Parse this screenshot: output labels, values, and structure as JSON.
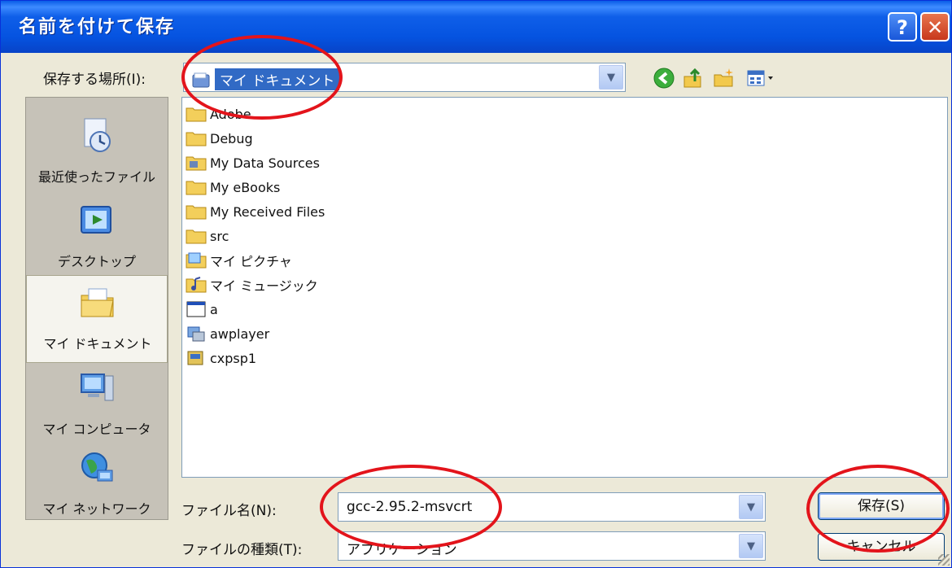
{
  "window": {
    "title": "名前を付けて保存",
    "help_glyph": "?",
    "close_glyph": "✕"
  },
  "location": {
    "label": "保存する場所(I):",
    "value": "マイ ドキュメント"
  },
  "toolbar": {
    "back_icon": "back-icon",
    "up_icon": "up-folder-icon",
    "new_folder_icon": "new-folder-icon",
    "views_icon": "views-menu-icon"
  },
  "places": [
    {
      "label": "最近使ったファイル",
      "icon": "recent-documents-icon"
    },
    {
      "label": "デスクトップ",
      "icon": "desktop-icon"
    },
    {
      "label": "マイ ドキュメント",
      "icon": "my-documents-icon",
      "active": true
    },
    {
      "label": "マイ コンピュータ",
      "icon": "my-computer-icon"
    },
    {
      "label": "マイ ネットワーク",
      "icon": "my-network-icon"
    }
  ],
  "files": [
    {
      "name": "Adobe",
      "icon": "folder-icon"
    },
    {
      "name": "Debug",
      "icon": "folder-icon"
    },
    {
      "name": "My Data Sources",
      "icon": "data-sources-folder-icon"
    },
    {
      "name": "My eBooks",
      "icon": "folder-icon"
    },
    {
      "name": "My Received Files",
      "icon": "folder-icon"
    },
    {
      "name": "src",
      "icon": "folder-icon"
    },
    {
      "name": "マイ ピクチャ",
      "icon": "pictures-folder-icon"
    },
    {
      "name": "マイ ミュージック",
      "icon": "music-folder-icon"
    },
    {
      "name": "a",
      "icon": "application-window-icon"
    },
    {
      "name": "awplayer",
      "icon": "application-icon"
    },
    {
      "name": "cxpsp1",
      "icon": "installer-icon"
    }
  ],
  "filename": {
    "label": "ファイル名(N):",
    "value": "gcc-2.95.2-msvcrt"
  },
  "filetype": {
    "label": "ファイルの種類(T):",
    "value": "アプリケーション"
  },
  "buttons": {
    "save": "保存(S)",
    "cancel": "キャンセル"
  },
  "colors": {
    "titlebar": "#0553e0",
    "selection": "#316ac5",
    "annotation_ring": "#e3141b",
    "dialog_bg": "#ece9d8"
  }
}
